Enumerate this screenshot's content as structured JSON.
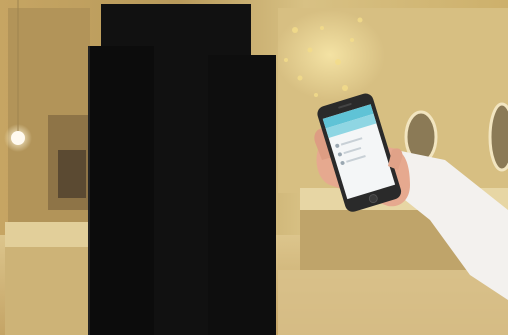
{
  "photo": {
    "subject": "hand-holding-smartphone-next-to-black-column",
    "palette": {
      "wall_warm": "#c9a968",
      "wall_light": "#e8d39a",
      "floor": "#d3b77a",
      "column": "#111111",
      "phone_frame": "#2a2a2a",
      "screen_header": "#5fc3d6",
      "screen_body": "#f4f6f7",
      "skin": "#e6a98f",
      "sleeve": "#f3f1ee"
    },
    "icons": [
      "ceiling-light-bokeh-icon",
      "round-mirror-icon",
      "app-list-item-icon"
    ]
  }
}
